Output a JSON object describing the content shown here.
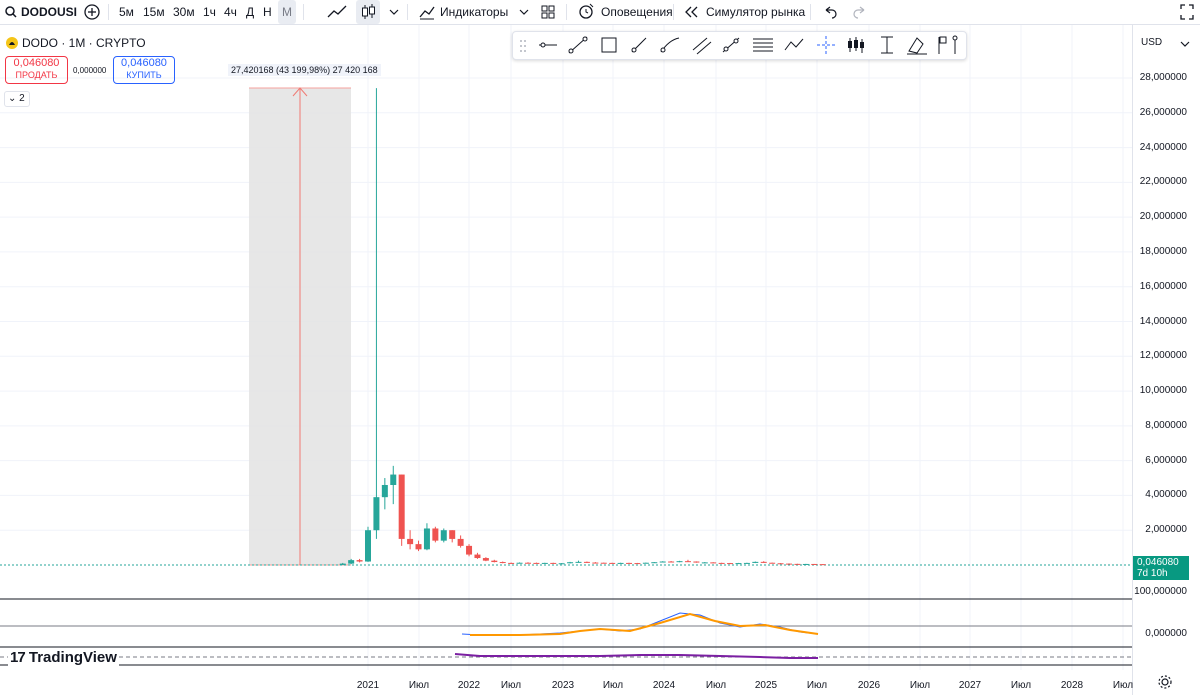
{
  "toolbar": {
    "symbol": "DODOUSI",
    "intervals": [
      "5м",
      "15м",
      "30м",
      "1ч",
      "4ч",
      "Д",
      "Н",
      "М"
    ],
    "active_interval": "М",
    "indicators_label": "Индикаторы",
    "alerts_label": "Оповещения",
    "simulator_label": "Симулятор рынка"
  },
  "legend": {
    "title": "DODO · 1M · CRYPTO",
    "sell_price": "0,046080",
    "sell_label": "ПРОДАТЬ",
    "spread": "0,000000",
    "buy_price": "0,046080",
    "buy_label": "КУПИТЬ",
    "collapse_count": "2"
  },
  "currency": "USD",
  "measure": {
    "label": "27,420168 (43 199,98%) 27 420 168"
  },
  "price_axis": {
    "ticks": [
      "28,000000",
      "26,000000",
      "24,000000",
      "22,000000",
      "20,000000",
      "18,000000",
      "16,000000",
      "14,000000",
      "12,000000",
      "10,000000",
      "8,000000",
      "6,000000",
      "4,000000",
      "2,000000"
    ],
    "last_price": "0,046080",
    "countdown": "7d 10h",
    "last_price_color": "#089981"
  },
  "indicator_axis": {
    "ticks": [
      "100,000000",
      "0,000000"
    ]
  },
  "time_axis": {
    "labels": [
      "2021",
      "Июл",
      "2022",
      "Июл",
      "2023",
      "Июл",
      "2024",
      "Июл",
      "2025",
      "Июл",
      "2026",
      "Июл",
      "2027",
      "Июл",
      "2028",
      "Июл"
    ]
  },
  "watermark": "TradingView",
  "colors": {
    "up": "#26a69a",
    "down": "#ef5350",
    "accent": "#2962ff"
  },
  "chart_data": {
    "type": "candlestick",
    "ylim": [
      0,
      28
    ],
    "candles": [
      {
        "t": "2020-10",
        "o": 0.01,
        "h": 0.12,
        "l": 0.0,
        "c": 0.08
      },
      {
        "t": "2020-11",
        "o": 0.08,
        "h": 0.35,
        "l": 0.05,
        "c": 0.28
      },
      {
        "t": "2020-12",
        "o": 0.28,
        "h": 0.35,
        "l": 0.15,
        "c": 0.2
      },
      {
        "t": "2021-01",
        "o": 0.2,
        "h": 2.2,
        "l": 0.18,
        "c": 2.0
      },
      {
        "t": "2021-02",
        "o": 2.0,
        "h": 27.42,
        "l": 1.5,
        "c": 3.9
      },
      {
        "t": "2021-03",
        "o": 3.9,
        "h": 5.0,
        "l": 3.2,
        "c": 4.6
      },
      {
        "t": "2021-04",
        "o": 4.6,
        "h": 5.7,
        "l": 3.5,
        "c": 5.2
      },
      {
        "t": "2021-05",
        "o": 5.2,
        "h": 4.5,
        "l": 1.1,
        "c": 1.5
      },
      {
        "t": "2021-06",
        "o": 1.5,
        "h": 2.0,
        "l": 0.9,
        "c": 1.2
      },
      {
        "t": "2021-07",
        "o": 1.2,
        "h": 1.4,
        "l": 0.8,
        "c": 0.9
      },
      {
        "t": "2021-08",
        "o": 0.9,
        "h": 2.4,
        "l": 0.85,
        "c": 2.1
      },
      {
        "t": "2021-09",
        "o": 2.1,
        "h": 2.2,
        "l": 1.3,
        "c": 1.4
      },
      {
        "t": "2021-10",
        "o": 1.4,
        "h": 2.1,
        "l": 1.3,
        "c": 2.0
      },
      {
        "t": "2021-11",
        "o": 2.0,
        "h": 2.0,
        "l": 1.3,
        "c": 1.5
      },
      {
        "t": "2021-12",
        "o": 1.5,
        "h": 1.7,
        "l": 1.0,
        "c": 1.1
      },
      {
        "t": "2022-01",
        "o": 1.1,
        "h": 1.2,
        "l": 0.5,
        "c": 0.6
      },
      {
        "t": "2022-02",
        "o": 0.6,
        "h": 0.7,
        "l": 0.35,
        "c": 0.4
      },
      {
        "t": "2022-03",
        "o": 0.4,
        "h": 0.45,
        "l": 0.22,
        "c": 0.25
      },
      {
        "t": "2022-04",
        "o": 0.25,
        "h": 0.3,
        "l": 0.15,
        "c": 0.17
      },
      {
        "t": "2022-05",
        "o": 0.17,
        "h": 0.2,
        "l": 0.1,
        "c": 0.12
      },
      {
        "t": "2022-06",
        "o": 0.12,
        "h": 0.14,
        "l": 0.08,
        "c": 0.1
      },
      {
        "t": "2022-07",
        "o": 0.1,
        "h": 0.15,
        "l": 0.09,
        "c": 0.13
      },
      {
        "t": "2022-08",
        "o": 0.13,
        "h": 0.16,
        "l": 0.1,
        "c": 0.12
      },
      {
        "t": "2022-09",
        "o": 0.12,
        "h": 0.14,
        "l": 0.1,
        "c": 0.11
      },
      {
        "t": "2022-10",
        "o": 0.11,
        "h": 0.13,
        "l": 0.1,
        "c": 0.12
      },
      {
        "t": "2022-11",
        "o": 0.12,
        "h": 0.13,
        "l": 0.08,
        "c": 0.09
      },
      {
        "t": "2022-12",
        "o": 0.09,
        "h": 0.11,
        "l": 0.08,
        "c": 0.1
      },
      {
        "t": "2023-01",
        "o": 0.1,
        "h": 0.18,
        "l": 0.09,
        "c": 0.16
      },
      {
        "t": "2023-02",
        "o": 0.16,
        "h": 0.25,
        "l": 0.14,
        "c": 0.18
      },
      {
        "t": "2023-03",
        "o": 0.18,
        "h": 0.2,
        "l": 0.12,
        "c": 0.14
      },
      {
        "t": "2023-04",
        "o": 0.14,
        "h": 0.17,
        "l": 0.12,
        "c": 0.13
      },
      {
        "t": "2023-05",
        "o": 0.13,
        "h": 0.14,
        "l": 0.11,
        "c": 0.12
      },
      {
        "t": "2023-06",
        "o": 0.12,
        "h": 0.13,
        "l": 0.09,
        "c": 0.1
      },
      {
        "t": "2023-07",
        "o": 0.1,
        "h": 0.13,
        "l": 0.1,
        "c": 0.12
      },
      {
        "t": "2023-08",
        "o": 0.12,
        "h": 0.13,
        "l": 0.1,
        "c": 0.11
      },
      {
        "t": "2023-09",
        "o": 0.11,
        "h": 0.12,
        "l": 0.1,
        "c": 0.105
      },
      {
        "t": "2023-10",
        "o": 0.105,
        "h": 0.14,
        "l": 0.1,
        "c": 0.13
      },
      {
        "t": "2023-11",
        "o": 0.13,
        "h": 0.17,
        "l": 0.12,
        "c": 0.16
      },
      {
        "t": "2023-12",
        "o": 0.16,
        "h": 0.22,
        "l": 0.15,
        "c": 0.2
      },
      {
        "t": "2024-01",
        "o": 0.2,
        "h": 0.23,
        "l": 0.15,
        "c": 0.17
      },
      {
        "t": "2024-02",
        "o": 0.17,
        "h": 0.24,
        "l": 0.16,
        "c": 0.22
      },
      {
        "t": "2024-03",
        "o": 0.22,
        "h": 0.3,
        "l": 0.18,
        "c": 0.2
      },
      {
        "t": "2024-04",
        "o": 0.2,
        "h": 0.21,
        "l": 0.13,
        "c": 0.14
      },
      {
        "t": "2024-05",
        "o": 0.14,
        "h": 0.17,
        "l": 0.13,
        "c": 0.15
      },
      {
        "t": "2024-06",
        "o": 0.15,
        "h": 0.16,
        "l": 0.11,
        "c": 0.12
      },
      {
        "t": "2024-07",
        "o": 0.12,
        "h": 0.13,
        "l": 0.1,
        "c": 0.11
      },
      {
        "t": "2024-08",
        "o": 0.11,
        "h": 0.12,
        "l": 0.09,
        "c": 0.1
      },
      {
        "t": "2024-09",
        "o": 0.1,
        "h": 0.12,
        "l": 0.1,
        "c": 0.11
      },
      {
        "t": "2024-10",
        "o": 0.11,
        "h": 0.13,
        "l": 0.1,
        "c": 0.12
      },
      {
        "t": "2024-11",
        "o": 0.12,
        "h": 0.2,
        "l": 0.11,
        "c": 0.18
      },
      {
        "t": "2024-12",
        "o": 0.18,
        "h": 0.22,
        "l": 0.12,
        "c": 0.13
      },
      {
        "t": "2025-01",
        "o": 0.13,
        "h": 0.14,
        "l": 0.09,
        "c": 0.1
      },
      {
        "t": "2025-02",
        "o": 0.1,
        "h": 0.11,
        "l": 0.07,
        "c": 0.08
      },
      {
        "t": "2025-03",
        "o": 0.08,
        "h": 0.09,
        "l": 0.06,
        "c": 0.065
      },
      {
        "t": "2025-04",
        "o": 0.065,
        "h": 0.07,
        "l": 0.05,
        "c": 0.055
      },
      {
        "t": "2025-05",
        "o": 0.055,
        "h": 0.065,
        "l": 0.05,
        "c": 0.06
      },
      {
        "t": "2025-06",
        "o": 0.06,
        "h": 0.062,
        "l": 0.045,
        "c": 0.05
      },
      {
        "t": "2025-07",
        "o": 0.05,
        "h": 0.055,
        "l": 0.044,
        "c": 0.04608
      }
    ]
  }
}
